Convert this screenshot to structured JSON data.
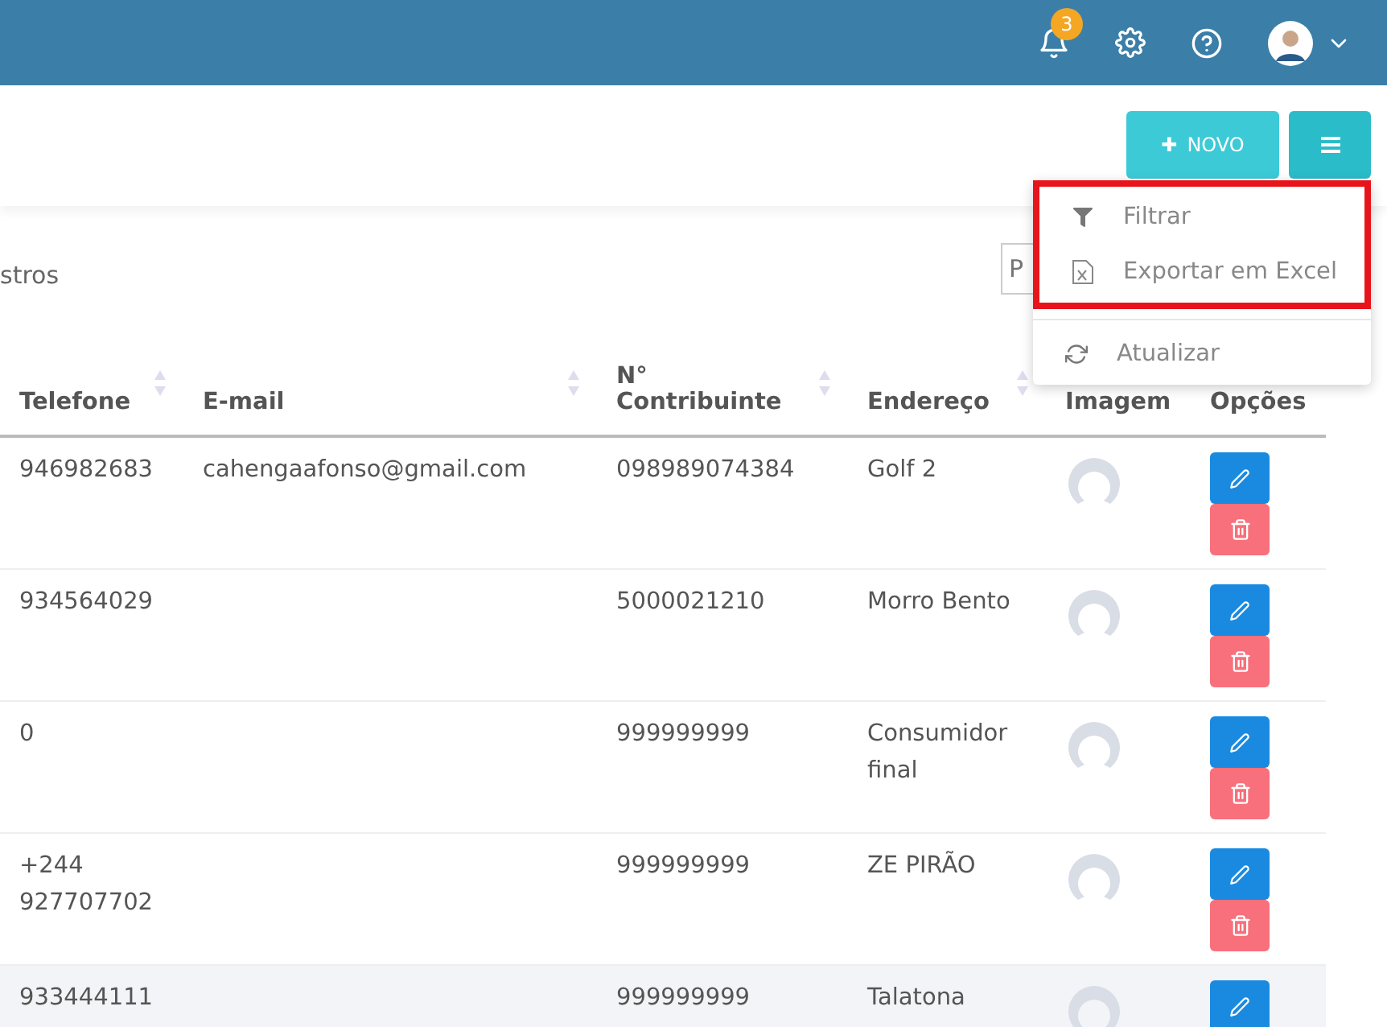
{
  "header": {
    "notifications": {
      "count": "3"
    }
  },
  "toolbar": {
    "new_button": {
      "icon": "✚",
      "label": "NOVO"
    }
  },
  "menu": {
    "sections": [
      {
        "highlighted": true,
        "items": [
          {
            "kind": "filter",
            "label": "Filtrar"
          },
          {
            "kind": "excel",
            "label": "Exportar em Excel"
          }
        ]
      },
      {
        "highlighted": false,
        "items": [
          {
            "kind": "refresh",
            "label": "Atualizar"
          }
        ]
      }
    ]
  },
  "records_label": "stros",
  "search": {
    "placeholder": "P"
  },
  "table": {
    "columns": [
      {
        "label": "Telefone",
        "sortable": true
      },
      {
        "label": "E-mail",
        "sortable": true
      },
      {
        "label": "N° Contribuinte",
        "sortable": true
      },
      {
        "label": "Endereço",
        "sortable": true
      },
      {
        "label": "Imagem"
      },
      {
        "label": "Opções"
      }
    ],
    "rows": [
      {
        "phone": "946982683",
        "email": "cahengaafonso@gmail.com",
        "nif": "098989074384",
        "address": "Golf 2",
        "hovered": false
      },
      {
        "phone": "934564029",
        "nif": "5000021210",
        "address": "Morro Bento",
        "hovered": false
      },
      {
        "phone": "0",
        "nif": "999999999",
        "address": "Consumidor final",
        "hovered": false
      },
      {
        "phone": "+244 927707702",
        "nif": "999999999",
        "address": "ZE PIRÃO",
        "hovered": false
      },
      {
        "phone": "933444111",
        "nif": "999999999",
        "address": "Talatona",
        "hovered": true
      }
    ]
  }
}
